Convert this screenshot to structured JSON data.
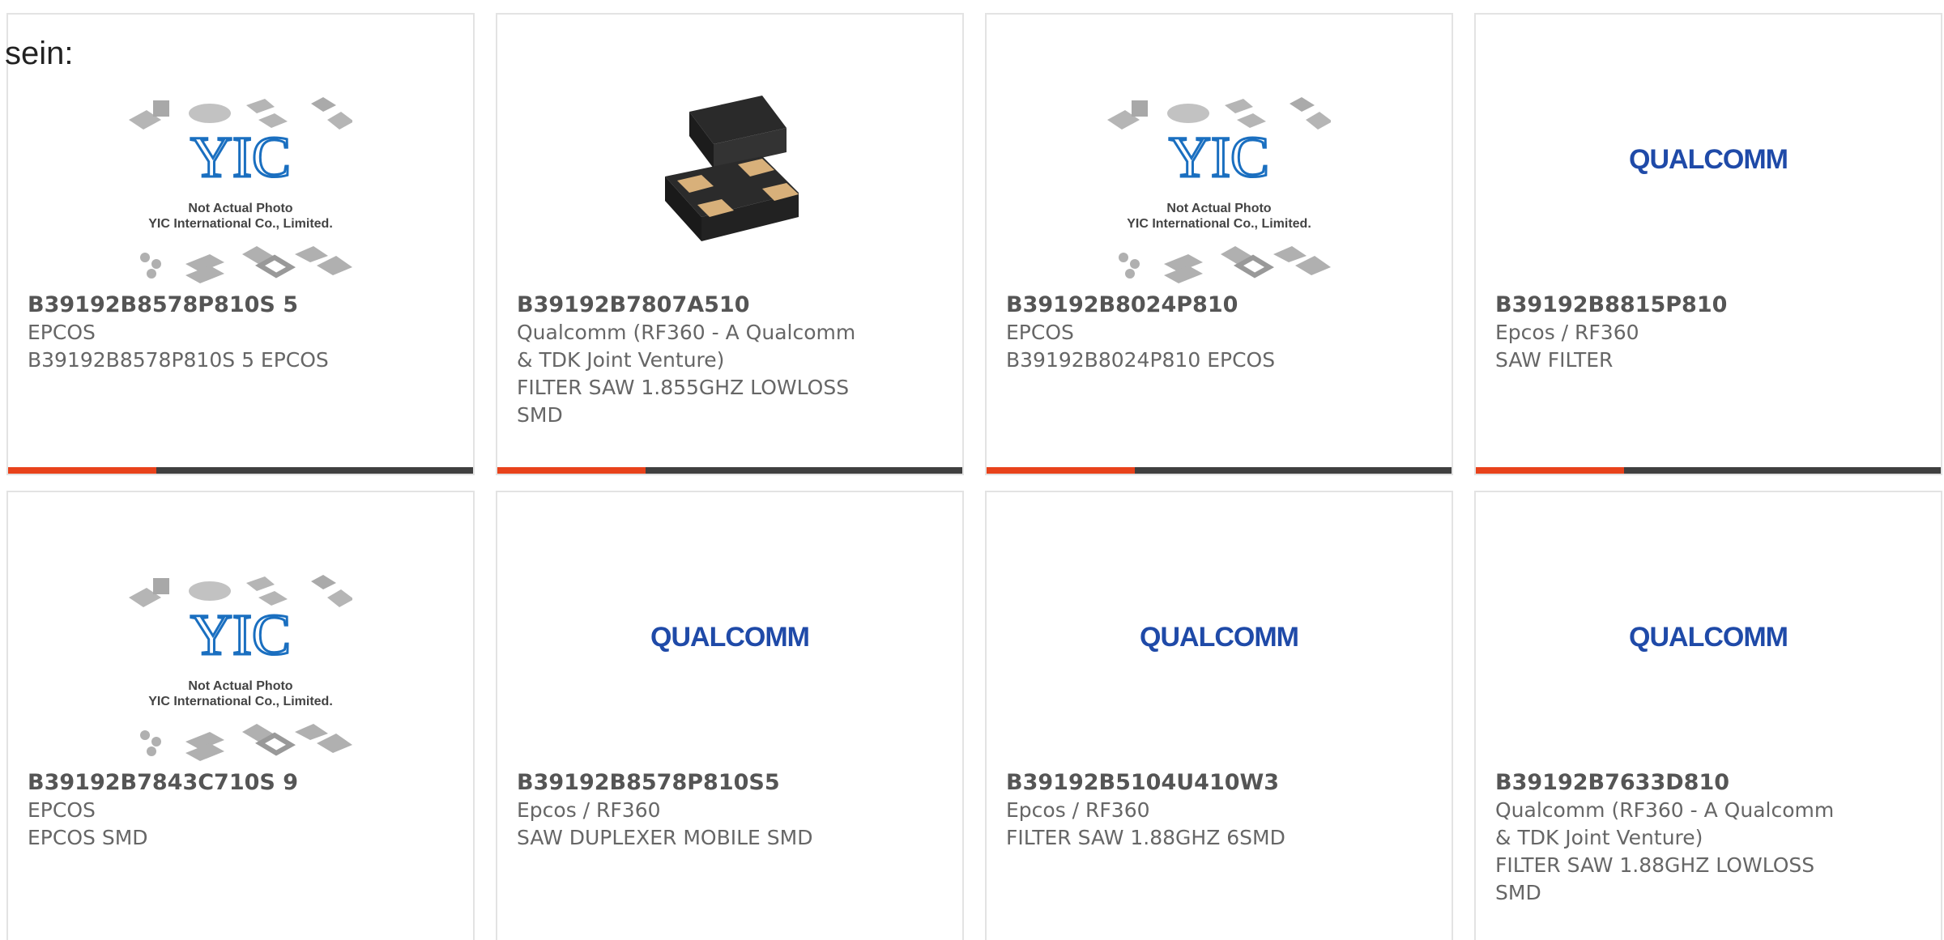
{
  "intro_text": "sein:",
  "placeholder_text": {
    "line1": "Not Actual Photo",
    "line2": "YIC International Co., Limited."
  },
  "brand": {
    "qualcomm_logo": "QUALCOMM",
    "yic_logo": "YIC"
  },
  "colors": {
    "accent": "#e8421b",
    "bar": "#3f3f3f",
    "qualcomm_blue": "#1f4aa8",
    "yic_blue": "#1a6fc0"
  },
  "products": [
    {
      "part_number": "B39192B8578P810S 5",
      "manufacturer": "EPCOS",
      "description": "B39192B8578P810S 5 EPCOS",
      "image": "yic-placeholder"
    },
    {
      "part_number": "B39192B7807A510",
      "manufacturer": "Qualcomm (RF360 - A Qualcomm & TDK Joint Venture)",
      "description": "FILTER SAW 1.855GHZ LOWLOSS SMD",
      "image": "chip-photo"
    },
    {
      "part_number": "B39192B8024P810",
      "manufacturer": "EPCOS",
      "description": "B39192B8024P810 EPCOS",
      "image": "yic-placeholder"
    },
    {
      "part_number": "B39192B8815P810",
      "manufacturer": "Epcos / RF360",
      "description": "SAW FILTER",
      "image": "qualcomm-logo"
    },
    {
      "part_number": "B39192B7843C710S 9",
      "manufacturer": "EPCOS",
      "description": "EPCOS SMD",
      "image": "yic-placeholder"
    },
    {
      "part_number": "B39192B8578P810S5",
      "manufacturer": "Epcos / RF360",
      "description": "SAW DUPLEXER MOBILE SMD",
      "image": "qualcomm-logo"
    },
    {
      "part_number": "B39192B5104U410W3",
      "manufacturer": "Epcos / RF360",
      "description": "FILTER SAW 1.88GHZ 6SMD",
      "image": "qualcomm-logo"
    },
    {
      "part_number": "B39192B7633D810",
      "manufacturer": "Qualcomm (RF360 - A Qualcomm & TDK Joint Venture)",
      "description": "FILTER SAW 1.88GHZ LOWLOSS SMD",
      "image": "qualcomm-logo"
    }
  ]
}
